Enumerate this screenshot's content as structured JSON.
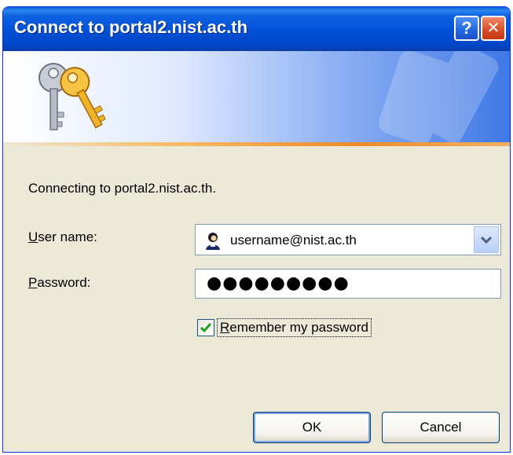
{
  "window": {
    "title": "Connect to portal2.nist.ac.th",
    "help_glyph": "?",
    "close_glyph": "✕"
  },
  "banner": {
    "icon": "keys-icon"
  },
  "dialog": {
    "message": "Connecting to portal2.nist.ac.th.",
    "username_label_accesskey": "U",
    "username_label_rest": "ser name:",
    "username_value": "username@nist.ac.th",
    "password_label_accesskey": "P",
    "password_label_rest": "assword:",
    "password_masked": "●●●●●●●●●",
    "remember_accesskey": "R",
    "remember_rest": "emember my password",
    "remember_checked": true
  },
  "buttons": {
    "ok": "OK",
    "cancel": "Cancel"
  },
  "colors": {
    "titlebar": "#0050d6",
    "dialog_bg": "#ece9d8",
    "accent_line": "#f08a28"
  }
}
